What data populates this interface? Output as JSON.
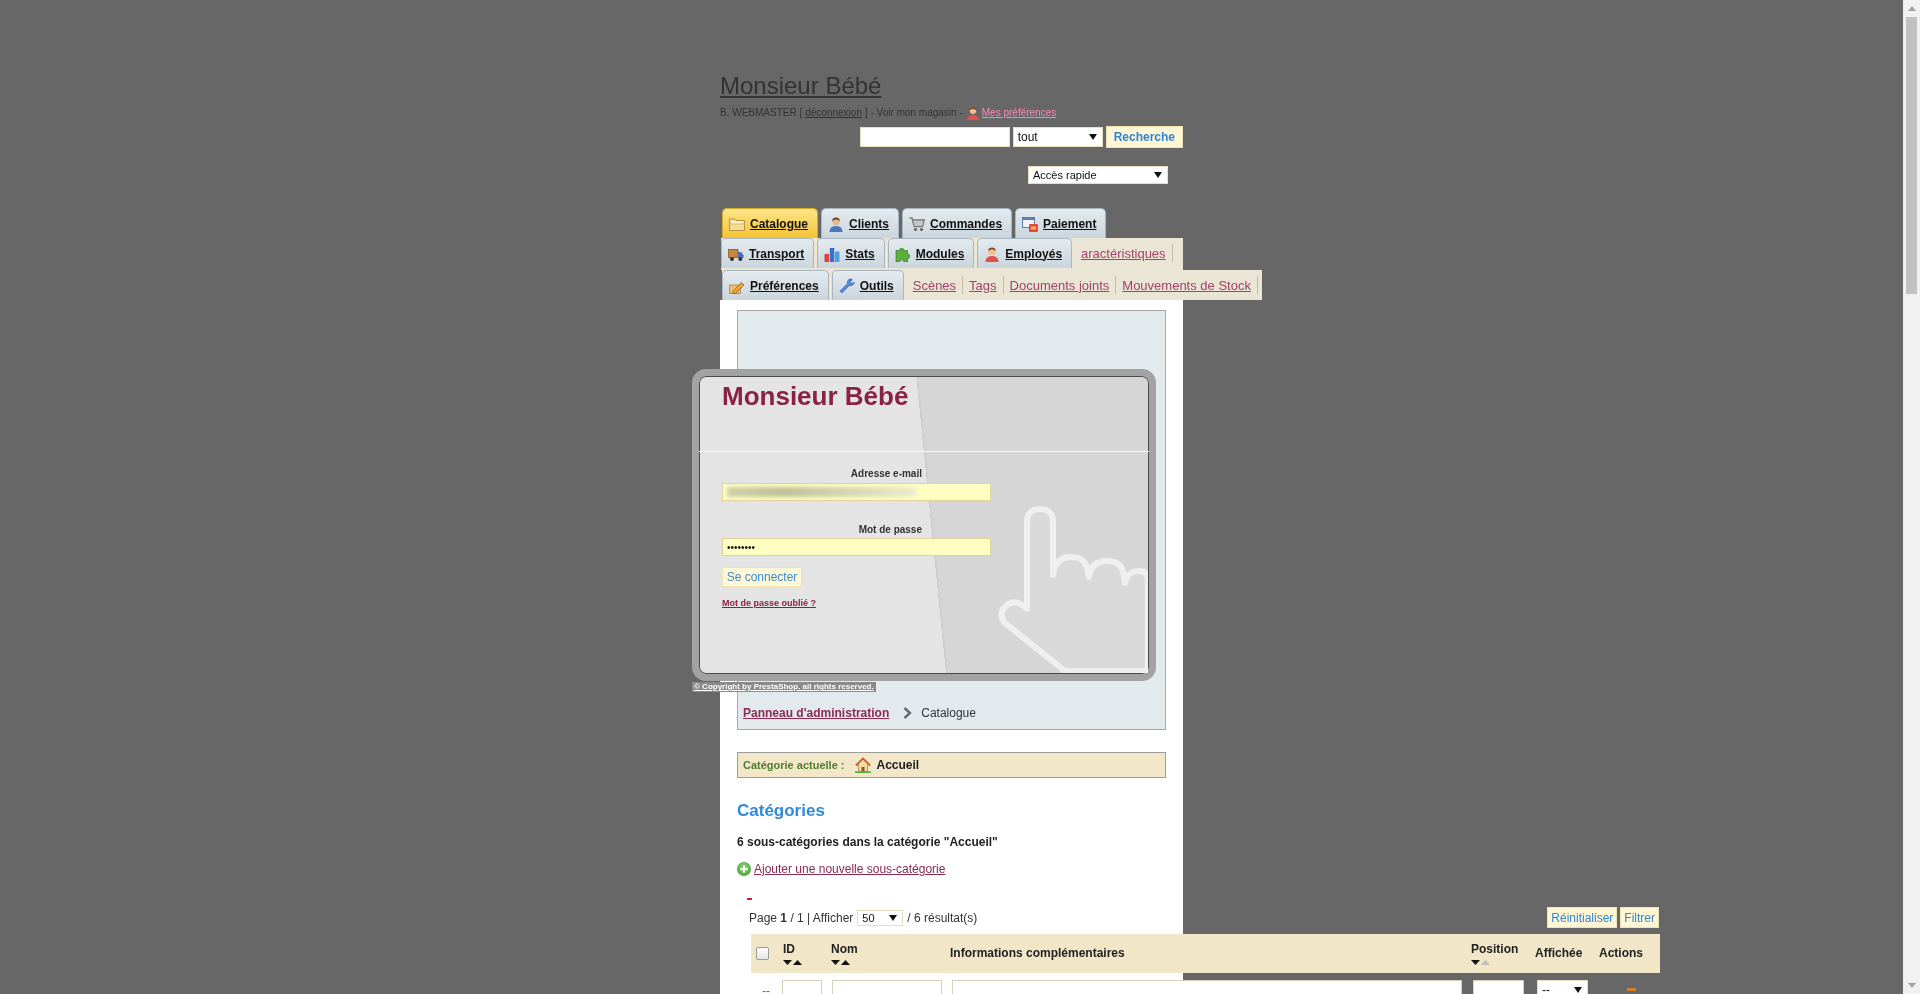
{
  "header": {
    "title": "Monsieur Bébé",
    "user_bar": [
      {
        "kind": "text",
        "text": "B. WEBMASTER ["
      },
      {
        "kind": "link",
        "text": "déconnexion"
      },
      {
        "kind": "text",
        "text": "] - Voir mon magasin -"
      },
      {
        "kind": "icon-link",
        "text": "Mes préférences"
      }
    ],
    "search": {
      "scope": "tout",
      "button": "Recherche"
    },
    "quick_access": "Accès rapide"
  },
  "tab_rows": [
    {
      "tabs": [
        {
          "label": "Catalogue",
          "selected": true
        },
        {
          "label": "Clients",
          "selected": false
        },
        {
          "label": "Commandes",
          "selected": false
        },
        {
          "label": "Paiement",
          "selected": false
        }
      ]
    },
    {
      "tabs": [
        {
          "label": "Transport",
          "selected": false
        },
        {
          "label": "Stats",
          "selected": false
        },
        {
          "label": "Modules",
          "selected": false
        },
        {
          "label": "Employés",
          "selected": false
        }
      ],
      "links": [
        "aractéristiques"
      ]
    },
    {
      "tabs": [
        {
          "label": "Préférences",
          "selected": false
        },
        {
          "label": "Outils",
          "selected": false
        }
      ],
      "links": [
        "Scènes",
        "Tags",
        "Documents joints",
        "Mouvements de Stock"
      ]
    }
  ],
  "login": {
    "title": "Monsieur Bébé",
    "email_label": "Adresse e-mail",
    "email_redacted": true,
    "password_label": "Mot de passe",
    "password_value": "••••••••",
    "submit": "Se connecter",
    "forgot_link": "Mot de passe oublié ?",
    "copyright": "© Copyright by PrestaShop. all rights reserved."
  },
  "breadcrumb": [
    {
      "kind": "link",
      "text": "Panneau d'administration"
    },
    {
      "kind": "current",
      "text": "Catalogue"
    }
  ],
  "current_category": {
    "label": "Catégorie actuelle :",
    "value": "Accueil"
  },
  "section": {
    "title": "Catégories",
    "summary": "6 sous-catégories dans la catégorie \"Accueil\"",
    "add_link": "Ajouter une nouvelle sous-catégorie"
  },
  "list": {
    "pager": {
      "text": "Page **1** / 1 | Afficher",
      "per_page": "50",
      "results": "/ 6 résultat(s)"
    },
    "buttons": [
      "Réinitialiser",
      "Filtrer"
    ],
    "columns": [
      {
        "kind": "checkbox",
        "checked": false
      },
      {
        "kind": "sortable",
        "label": "ID",
        "sorted": false
      },
      {
        "kind": "sortable",
        "label": "Nom",
        "sorted": false
      },
      {
        "kind": "plain",
        "label": "Informations complémentaires"
      },
      {
        "kind": "sortable",
        "label": "Position",
        "sorted": true
      },
      {
        "kind": "plain",
        "label": "Affichée"
      },
      {
        "kind": "plain",
        "label": "Actions"
      }
    ],
    "filters": [
      {
        "kind": "text",
        "text": "--"
      },
      {
        "kind": "input"
      },
      {
        "kind": "input"
      },
      {
        "kind": "input"
      },
      {
        "kind": "input"
      },
      {
        "kind": "select",
        "value": "--"
      },
      {
        "kind": "icon"
      }
    ]
  }
}
